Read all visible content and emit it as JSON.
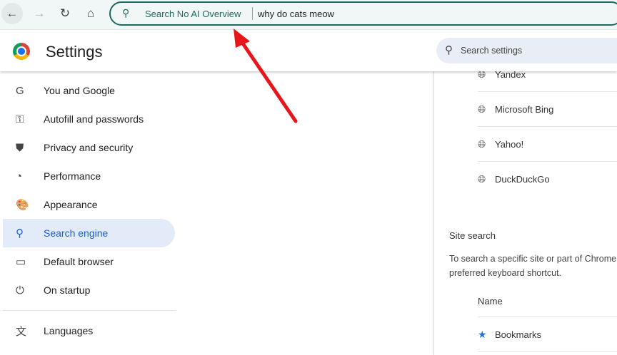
{
  "toolbar": {
    "keyword": "Search No AI Overview",
    "query": "why do cats meow"
  },
  "header": {
    "title": "Settings",
    "search_placeholder": "Search settings"
  },
  "sidebar": {
    "items": [
      {
        "label": "You and Google",
        "icon": "G"
      },
      {
        "label": "Autofill and passwords",
        "icon": "⚿"
      },
      {
        "label": "Privacy and security",
        "icon": "⛊"
      },
      {
        "label": "Performance",
        "icon": "◔"
      },
      {
        "label": "Appearance",
        "icon": "🎨"
      },
      {
        "label": "Search engine",
        "icon": "🔍"
      },
      {
        "label": "Default browser",
        "icon": "▭"
      },
      {
        "label": "On startup",
        "icon": "⏻"
      },
      {
        "label": "Languages",
        "icon": "文"
      }
    ]
  },
  "engines": [
    "Yandex",
    "Microsoft Bing",
    "Yahoo!",
    "DuckDuckGo"
  ],
  "site_search": {
    "heading": "Site search",
    "desc1": "To search a specific site or part of Chrome",
    "desc2": "preferred keyboard shortcut.",
    "column": "Name",
    "first": "Bookmarks"
  },
  "colors": {
    "accent": "#1a73e8",
    "annotation": "#e8161b"
  }
}
